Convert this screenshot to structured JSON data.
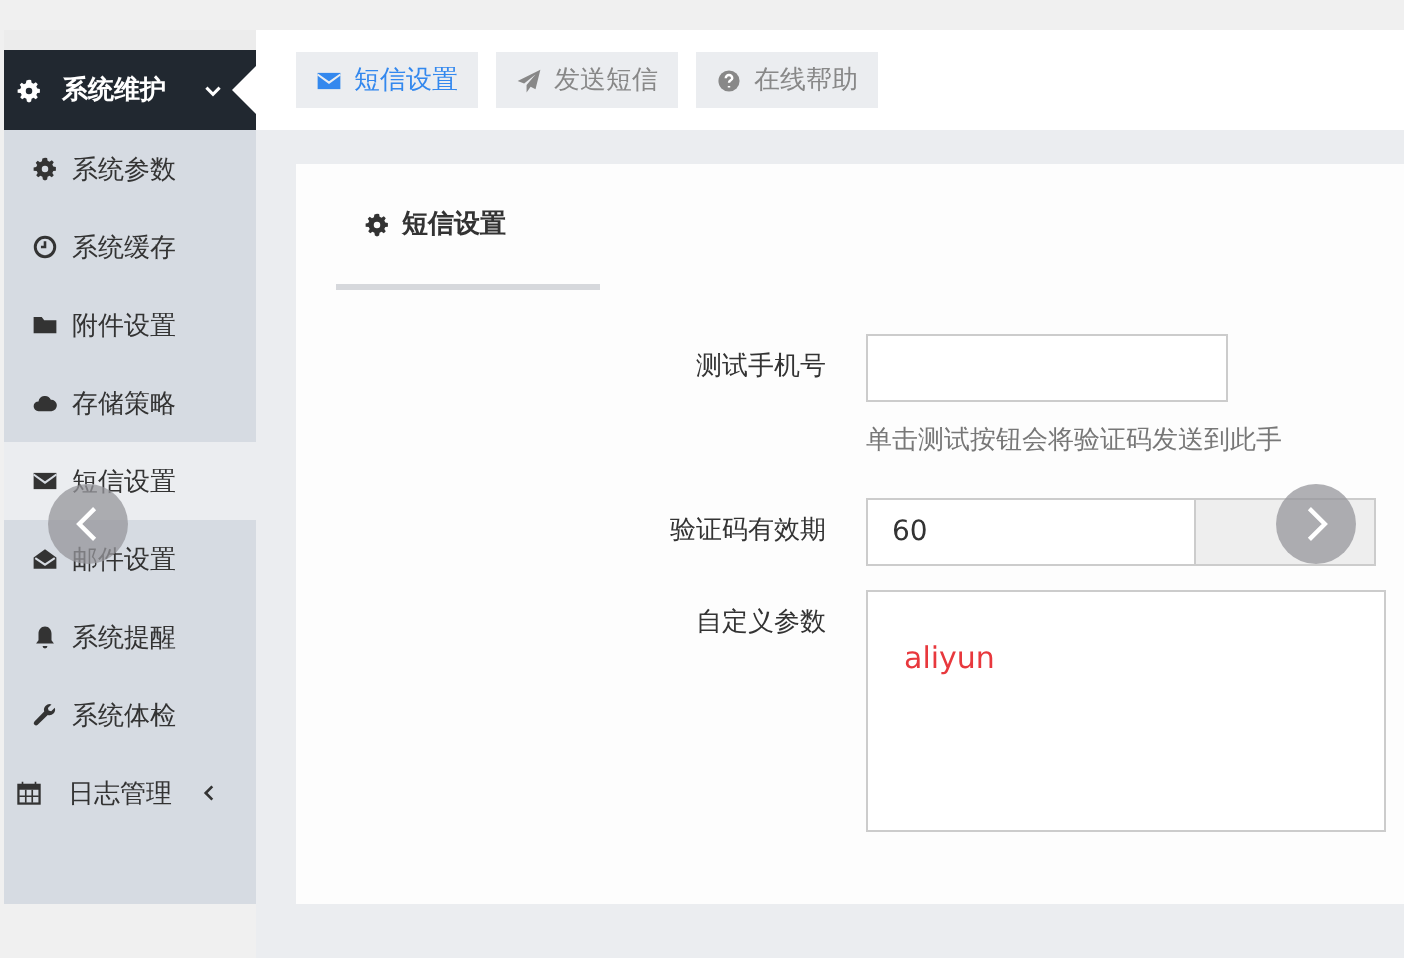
{
  "sidebar": {
    "group": {
      "label": "系统维护",
      "expanded": true
    },
    "items": [
      {
        "label": "系统参数",
        "selected": false
      },
      {
        "label": "系统缓存",
        "selected": false
      },
      {
        "label": "附件设置",
        "selected": false
      },
      {
        "label": "存储策略",
        "selected": false
      },
      {
        "label": "短信设置",
        "selected": true
      },
      {
        "label": "邮件设置",
        "selected": false
      },
      {
        "label": "系统提醒",
        "selected": false
      },
      {
        "label": "系统体检",
        "selected": false
      }
    ],
    "footer_group": {
      "label": "日志管理",
      "expanded": false
    }
  },
  "toolbar": [
    {
      "label": "短信设置",
      "selected": true
    },
    {
      "label": "发送短信",
      "selected": false
    },
    {
      "label": "在线帮助",
      "selected": false
    }
  ],
  "card": {
    "tab": {
      "label": "短信设置",
      "selected": true
    },
    "fields": [
      {
        "kind": "input",
        "label": "测试手机号",
        "help": "单击测试按钮会将验证码发送到此手"
      },
      {
        "kind": "addon",
        "label": "验证码有效期",
        "value": "60"
      },
      {
        "kind": "textarea",
        "label": "自定义参数",
        "value": "aliyun"
      }
    ]
  }
}
